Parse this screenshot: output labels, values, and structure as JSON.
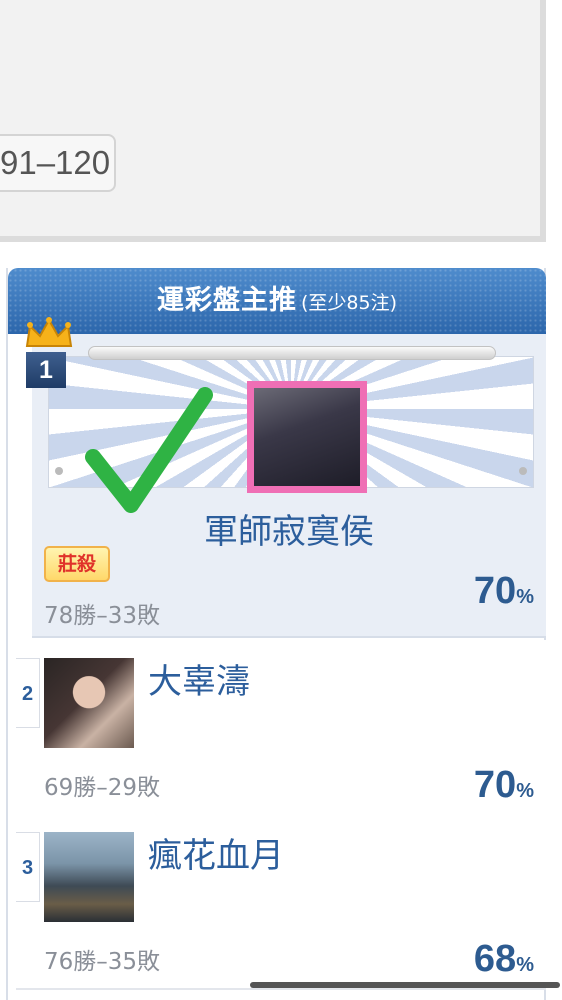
{
  "pagination": {
    "range_label": "91–120"
  },
  "ranking": {
    "title": "運彩盤主推",
    "subtitle": "(至少85注)",
    "entries": [
      {
        "rank": "1",
        "name": "軍師寂寞侯",
        "tag": "莊殺",
        "record": "78勝–33敗",
        "percent": "70",
        "percent_unit": "%"
      },
      {
        "rank": "2",
        "name": "大辜濤",
        "record": "69勝–29敗",
        "percent": "70",
        "percent_unit": "%"
      },
      {
        "rank": "3",
        "name": "瘋花血月",
        "record": "76勝–35敗",
        "percent": "68",
        "percent_unit": "%"
      }
    ]
  },
  "icons": {
    "crown": "crown-icon",
    "check": "checkmark-icon"
  },
  "colors": {
    "header_blue": "#2f6bb1",
    "name_blue": "#2c5e9c",
    "check_green": "#2fb344",
    "photo_frame_pink": "#ef6fb5"
  }
}
